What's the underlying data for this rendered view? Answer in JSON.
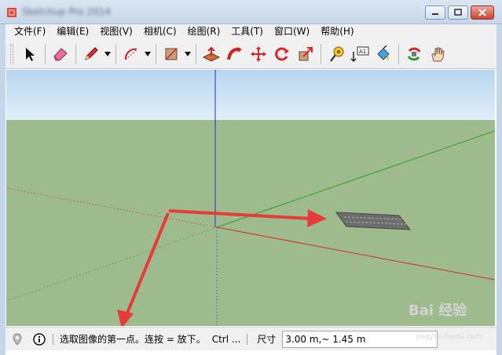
{
  "window": {
    "title": "Sketchup Pro 2014",
    "buttons": {
      "minimize": "minimize",
      "maximize": "maximize",
      "close": "close"
    }
  },
  "menubar": {
    "items": [
      {
        "label": "文件(F)"
      },
      {
        "label": "编辑(E)"
      },
      {
        "label": "视图(V)"
      },
      {
        "label": "相机(C)"
      },
      {
        "label": "绘图(R)"
      },
      {
        "label": "工具(T)"
      },
      {
        "label": "窗口(W)"
      },
      {
        "label": "帮助(H)"
      }
    ]
  },
  "toolbar": {
    "tools": [
      {
        "name": "select-tool",
        "icon": "arrow-cursor-icon"
      },
      {
        "name": "eraser-tool",
        "icon": "eraser-icon"
      },
      {
        "name": "pencil-line-tool",
        "icon": "pencil-icon"
      },
      {
        "name": "arc-tool",
        "icon": "arc-icon"
      },
      {
        "name": "rectangle-tool",
        "icon": "rectangle-icon"
      },
      {
        "name": "push-pull-tool",
        "icon": "push-pull-icon"
      },
      {
        "name": "follow-me-tool",
        "icon": "follow-me-icon"
      },
      {
        "name": "move-tool",
        "icon": "move-icon"
      },
      {
        "name": "rotate-tool",
        "icon": "rotate-icon"
      },
      {
        "name": "scale-tool",
        "icon": "scale-icon"
      },
      {
        "name": "tape-measure-tool",
        "icon": "tape-measure-icon"
      },
      {
        "name": "text-tool",
        "icon": "text-label-icon"
      },
      {
        "name": "paint-bucket-tool",
        "icon": "paint-bucket-icon"
      },
      {
        "name": "orbit-tool",
        "icon": "orbit-icon"
      },
      {
        "name": "pan-tool",
        "icon": "hand-icon"
      }
    ],
    "text_tool_label": "A1"
  },
  "viewport": {
    "sky_color": "#c9e2f4",
    "ground_color": "#9dbb8c",
    "axis_colors": {
      "red": "#d22b2b",
      "green": "#2aa02a",
      "blue": "#2b2bd2"
    }
  },
  "statusbar": {
    "hint": "选取图像的第一点。连按 = 放下。",
    "ctrl_hint": "Ctrl ...",
    "measure_label": "尺寸",
    "measure_value": "3.00 m,~ 1.45 m"
  },
  "watermark": {
    "text": "Bai 经验",
    "sub": "jingyan.baidu.com"
  }
}
